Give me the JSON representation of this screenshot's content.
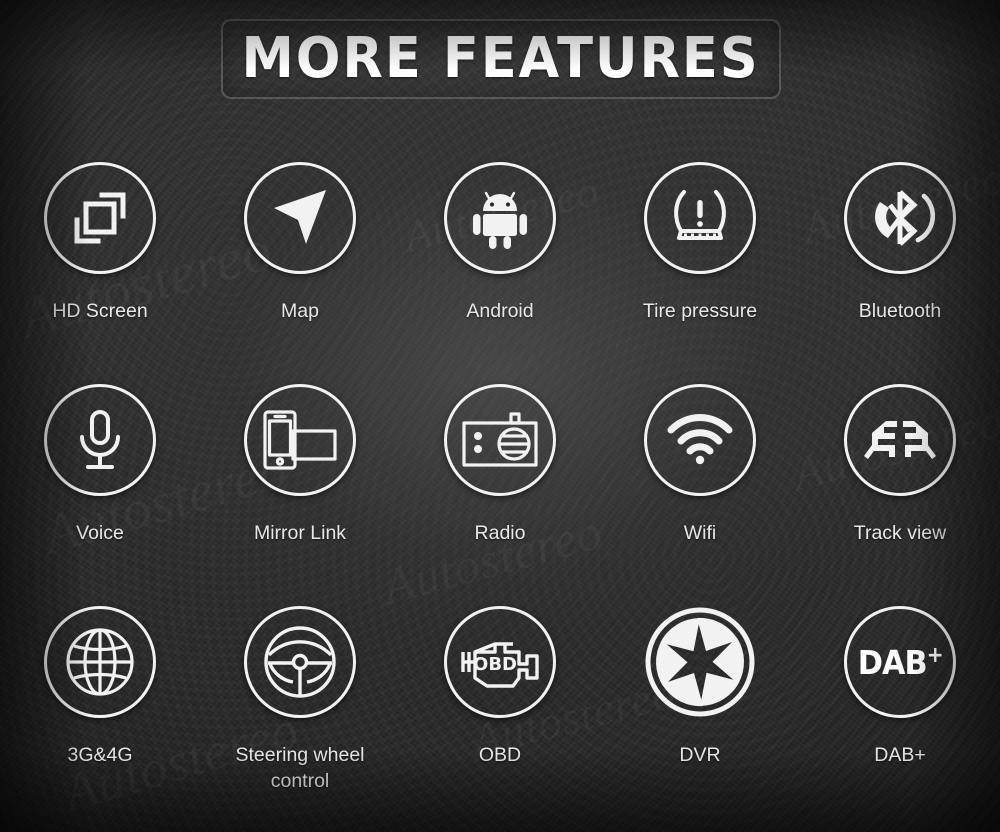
{
  "header": {
    "title": "MORE FEATURES"
  },
  "theme": {
    "background": "#2f2f2f",
    "icon_stroke": "#f2f2f2",
    "label_color": "#e9e9e9",
    "title_color": "#ffffff",
    "border_color": "rgba(255,255,255,0.17)"
  },
  "watermark": {
    "text": "Autostereo"
  },
  "features": [
    {
      "label": "HD Screen",
      "icon": "hd-screen-icon"
    },
    {
      "label": "Map",
      "icon": "navigation-arrow-icon"
    },
    {
      "label": "Android",
      "icon": "android-robot-icon"
    },
    {
      "label": "Tire pressure",
      "icon": "tire-pressure-warning-icon"
    },
    {
      "label": "Bluetooth",
      "icon": "bluetooth-phone-icon"
    },
    {
      "label": "Voice",
      "icon": "microphone-icon"
    },
    {
      "label": "Mirror Link",
      "icon": "mirror-link-icon"
    },
    {
      "label": "Radio",
      "icon": "radio-icon"
    },
    {
      "label": "Wifi",
      "icon": "wifi-icon"
    },
    {
      "label": "Track view",
      "icon": "track-view-icon"
    },
    {
      "label": "3G&4G",
      "icon": "globe-icon"
    },
    {
      "label": "Steering wheel control",
      "icon": "steering-wheel-icon"
    },
    {
      "label": "OBD",
      "icon": "obd-engine-icon"
    },
    {
      "label": "DVR",
      "icon": "camera-aperture-icon"
    },
    {
      "label": "DAB+",
      "icon": "dab-plus-icon"
    }
  ],
  "icon_text": {
    "obd": "OBD",
    "dab": "DAB",
    "dab_plus": "+"
  }
}
